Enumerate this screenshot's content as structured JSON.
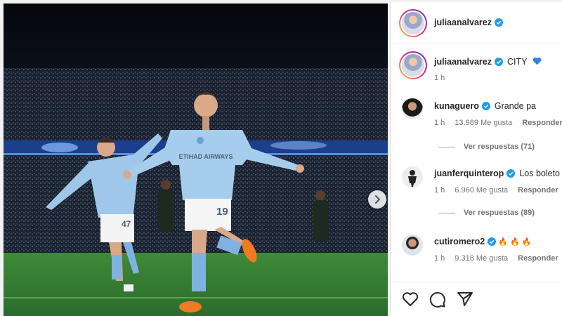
{
  "post": {
    "author": "juliaanalvarez",
    "author_verified": true
  },
  "caption": {
    "username": "juliaanalvarez",
    "text": "CITY",
    "emoji": "💙",
    "time": "1 h"
  },
  "comments": [
    {
      "username": "kunaguero",
      "text": "Grande pa",
      "time": "1 h",
      "likes": "13.989 Me gusta",
      "reply_label": "Responder",
      "view_replies": "Ver respuestas (71)"
    },
    {
      "username": "juanferquinterop",
      "text": "Los boleto",
      "time": "1 h",
      "likes": "6.960 Me gusta",
      "reply_label": "Responder",
      "view_replies": "Ver respuestas (89)"
    },
    {
      "username": "cutiromero2",
      "text": "🔥 🔥 🔥",
      "time": "1 h",
      "likes": "9.318 Me gusta",
      "reply_label": "Responder"
    }
  ],
  "photo": {
    "jersey_sponsor": "ETIHAD AIRWAYS",
    "number_left": "47",
    "number_center": "19"
  },
  "icons": {
    "like": "heart-icon",
    "comment": "comment-icon",
    "share": "send-icon",
    "next": "chevron-right-icon",
    "verified": "verified-badge-icon"
  },
  "colors": {
    "verified": "#1d9bf0",
    "city_blue": "#98c5e9",
    "pitch_green": "#2e7d32"
  }
}
